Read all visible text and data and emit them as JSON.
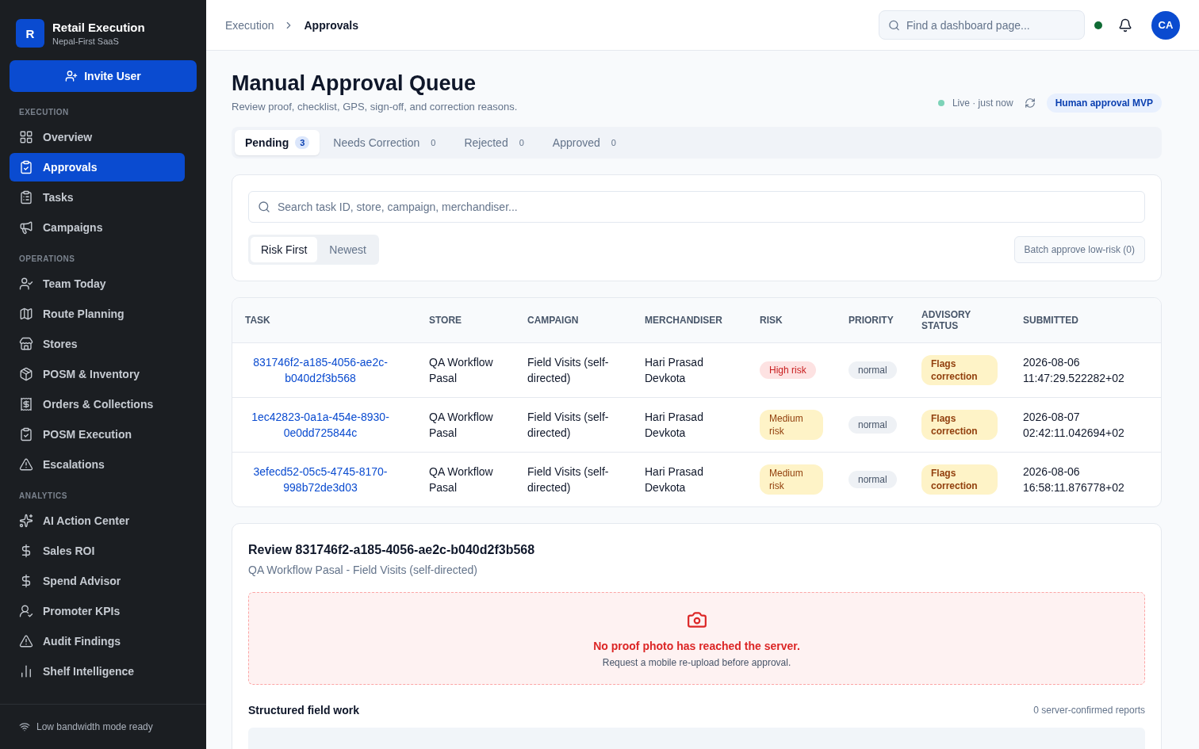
{
  "brand": {
    "logo": "R",
    "name": "Retail Execution",
    "tagline": "Nepal-First SaaS"
  },
  "invite_button": "Invite User",
  "sidebar": {
    "sections": [
      {
        "title": "EXECUTION",
        "items": [
          {
            "label": "Overview",
            "selected": false
          },
          {
            "label": "Approvals",
            "selected": true
          },
          {
            "label": "Tasks",
            "selected": false
          },
          {
            "label": "Campaigns",
            "selected": false
          }
        ]
      },
      {
        "title": "OPERATIONS",
        "items": [
          {
            "label": "Team Today",
            "selected": false
          },
          {
            "label": "Route Planning",
            "selected": false
          },
          {
            "label": "Stores",
            "selected": false
          },
          {
            "label": "POSM & Inventory",
            "selected": false
          },
          {
            "label": "Orders & Collections",
            "selected": false
          },
          {
            "label": "POSM Execution",
            "selected": false
          },
          {
            "label": "Escalations",
            "selected": false
          }
        ]
      },
      {
        "title": "ANALYTICS",
        "items": [
          {
            "label": "AI Action Center",
            "selected": false
          },
          {
            "label": "Sales ROI",
            "selected": false
          },
          {
            "label": "Spend Advisor",
            "selected": false
          },
          {
            "label": "Promoter KPIs",
            "selected": false
          },
          {
            "label": "Audit Findings",
            "selected": false
          },
          {
            "label": "Shelf Intelligence",
            "selected": false
          }
        ]
      }
    ],
    "footer": "Low bandwidth mode ready"
  },
  "breadcrumb": [
    "Execution",
    "Approvals"
  ],
  "top_search": {
    "placeholder": "Find a dashboard page..."
  },
  "status_dot": {
    "color": "#0f6b34"
  },
  "avatar": "CA",
  "page": {
    "title": "Manual Approval Queue",
    "subtitle": "Review proof, checklist, GPS, sign-off, and correction reasons.",
    "live": "Live · just now",
    "badge": "Human approval MVP"
  },
  "tabs": [
    {
      "label": "Pending",
      "count": "3",
      "selected": true
    },
    {
      "label": "Needs Correction",
      "count": "0",
      "selected": false
    },
    {
      "label": "Rejected",
      "count": "0",
      "selected": false
    },
    {
      "label": "Approved",
      "count": "0",
      "selected": false
    }
  ],
  "filter": {
    "placeholder": "Search task ID, store, campaign, merchandiser...",
    "sort": [
      {
        "label": "Risk First",
        "selected": true
      },
      {
        "label": "Newest",
        "selected": false
      }
    ],
    "batch_button": "Batch approve low-risk (0)"
  },
  "table": {
    "columns": [
      "TASK",
      "STORE",
      "CAMPAIGN",
      "MERCHANDISER",
      "RISK",
      "PRIORITY",
      "ADVISORY STATUS",
      "SUBMITTED"
    ],
    "rows": [
      {
        "task": "831746f2-a185-4056-ae2c-b040d2f3b568",
        "store": "QA Workflow Pasal",
        "campaign": "Field Visits (self-directed)",
        "merchandiser": "Hari Prasad Devkota",
        "risk": {
          "label": "High risk",
          "kind": "high"
        },
        "priority": "normal",
        "advisory": "Flags correction",
        "submitted": "2026-08-06 11:47:29.522282+02"
      },
      {
        "task": "1ec42823-0a1a-454e-8930-0e0dd725844c",
        "store": "QA Workflow Pasal",
        "campaign": "Field Visits (self-directed)",
        "merchandiser": "Hari Prasad Devkota",
        "risk": {
          "label": "Medium risk",
          "kind": "medium"
        },
        "priority": "normal",
        "advisory": "Flags correction",
        "submitted": "2026-08-07 02:42:11.042694+02"
      },
      {
        "task": "3efecd52-05c5-4745-8170-998b72de3d03",
        "store": "QA Workflow Pasal",
        "campaign": "Field Visits (self-directed)",
        "merchandiser": "Hari Prasad Devkota",
        "risk": {
          "label": "Medium risk",
          "kind": "medium"
        },
        "priority": "normal",
        "advisory": "Flags correction",
        "submitted": "2026-08-06 16:58:11.876778+02"
      }
    ]
  },
  "review": {
    "title": "Review 831746f2-a185-4056-ae2c-b040d2f3b568",
    "subtitle": "QA Workflow Pasal - Field Visits (self-directed)",
    "alert_title": "No proof photo has reached the server.",
    "alert_text": "Request a mobile re-upload before approval.",
    "section": "Structured field work",
    "section_note": "0 server-confirmed reports"
  }
}
